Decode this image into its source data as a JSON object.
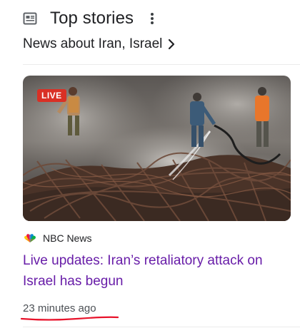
{
  "header": {
    "icon": "news-icon",
    "title": "Top stories",
    "menu_icon": "more-vert-icon"
  },
  "subheader": {
    "text": "News about Iran, Israel",
    "icon": "chevron-right-icon"
  },
  "story": {
    "badge": "LIVE",
    "image_description_icon": "news-photo",
    "source": "NBC News",
    "headline": "Live updates: Iran’s retaliatory attack on Israel has begun",
    "timestamp": "23 minutes ago"
  },
  "colors": {
    "headline_visited": "#681da8",
    "live_badge": "#d93025",
    "annotation_underline": "#e8132b",
    "text_primary": "#202124",
    "text_secondary": "#4d5156"
  }
}
